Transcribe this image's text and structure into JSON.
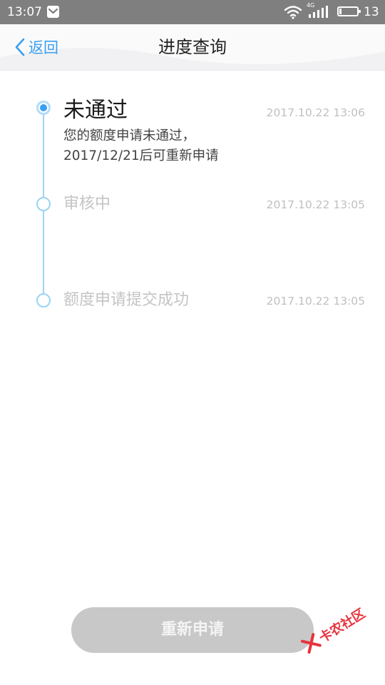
{
  "status_bar": {
    "time": "13:07",
    "network_type": "4G",
    "battery_level": "13",
    "battery_fraction": 0.13,
    "icons": [
      "app-notification-icon",
      "wifi-icon",
      "signal-icon",
      "battery-icon"
    ]
  },
  "nav": {
    "back_label": "返回",
    "title": "进度查询"
  },
  "timeline": {
    "steps": [
      {
        "title": "未通过",
        "time": "2017.10.22 13:06",
        "desc_line1": "您的额度申请未通过，",
        "desc_line2": "2017/12/21后可重新申请",
        "state": "current"
      },
      {
        "title": "审核中",
        "time": "2017.10.22 13:05",
        "state": "past"
      },
      {
        "title": "额度申请提交成功",
        "time": "2017.10.22 13:05",
        "state": "past"
      }
    ]
  },
  "actions": {
    "reapply_label": "重新申请"
  },
  "watermark": {
    "text": "卡农社区"
  },
  "colors": {
    "accent": "#3a9ff0",
    "timeline_line": "#9ad3f5",
    "button_disabled": "#c8c8c8",
    "status_bar": "#7f7f7f",
    "watermark": "#e8323c"
  }
}
